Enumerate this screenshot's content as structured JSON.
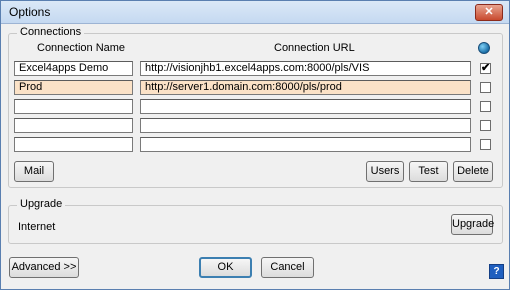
{
  "window": {
    "title": "Options",
    "close_label": "✕"
  },
  "connections": {
    "group_label": "Connections",
    "col_name": "Connection Name",
    "col_url": "Connection URL",
    "globe_icon": "globe-icon",
    "rows": [
      {
        "name": "Excel4apps Demo",
        "url": "http://visionjhb1.excel4apps.com:8000/pls/VIS",
        "checked": "✔"
      },
      {
        "name": "Prod",
        "url": "http://server1.domain.com:8000/pls/prod",
        "checked": ""
      },
      {
        "name": "",
        "url": "",
        "checked": ""
      },
      {
        "name": "",
        "url": "",
        "checked": ""
      },
      {
        "name": "",
        "url": "",
        "checked": ""
      }
    ],
    "mail_label": "Mail",
    "users_label": "Users",
    "test_label": "Test",
    "delete_label": "Delete"
  },
  "upgrade": {
    "group_label": "Upgrade",
    "status_text": "Internet",
    "button_label": "Upgrade"
  },
  "footer": {
    "advanced_label": "Advanced >>",
    "ok_label": "OK",
    "cancel_label": "Cancel",
    "help_label": "?"
  },
  "colors": {
    "selected_row": "#fbe2c7",
    "title_bar": "#c5d9f1",
    "close_button": "#c84a2f"
  }
}
